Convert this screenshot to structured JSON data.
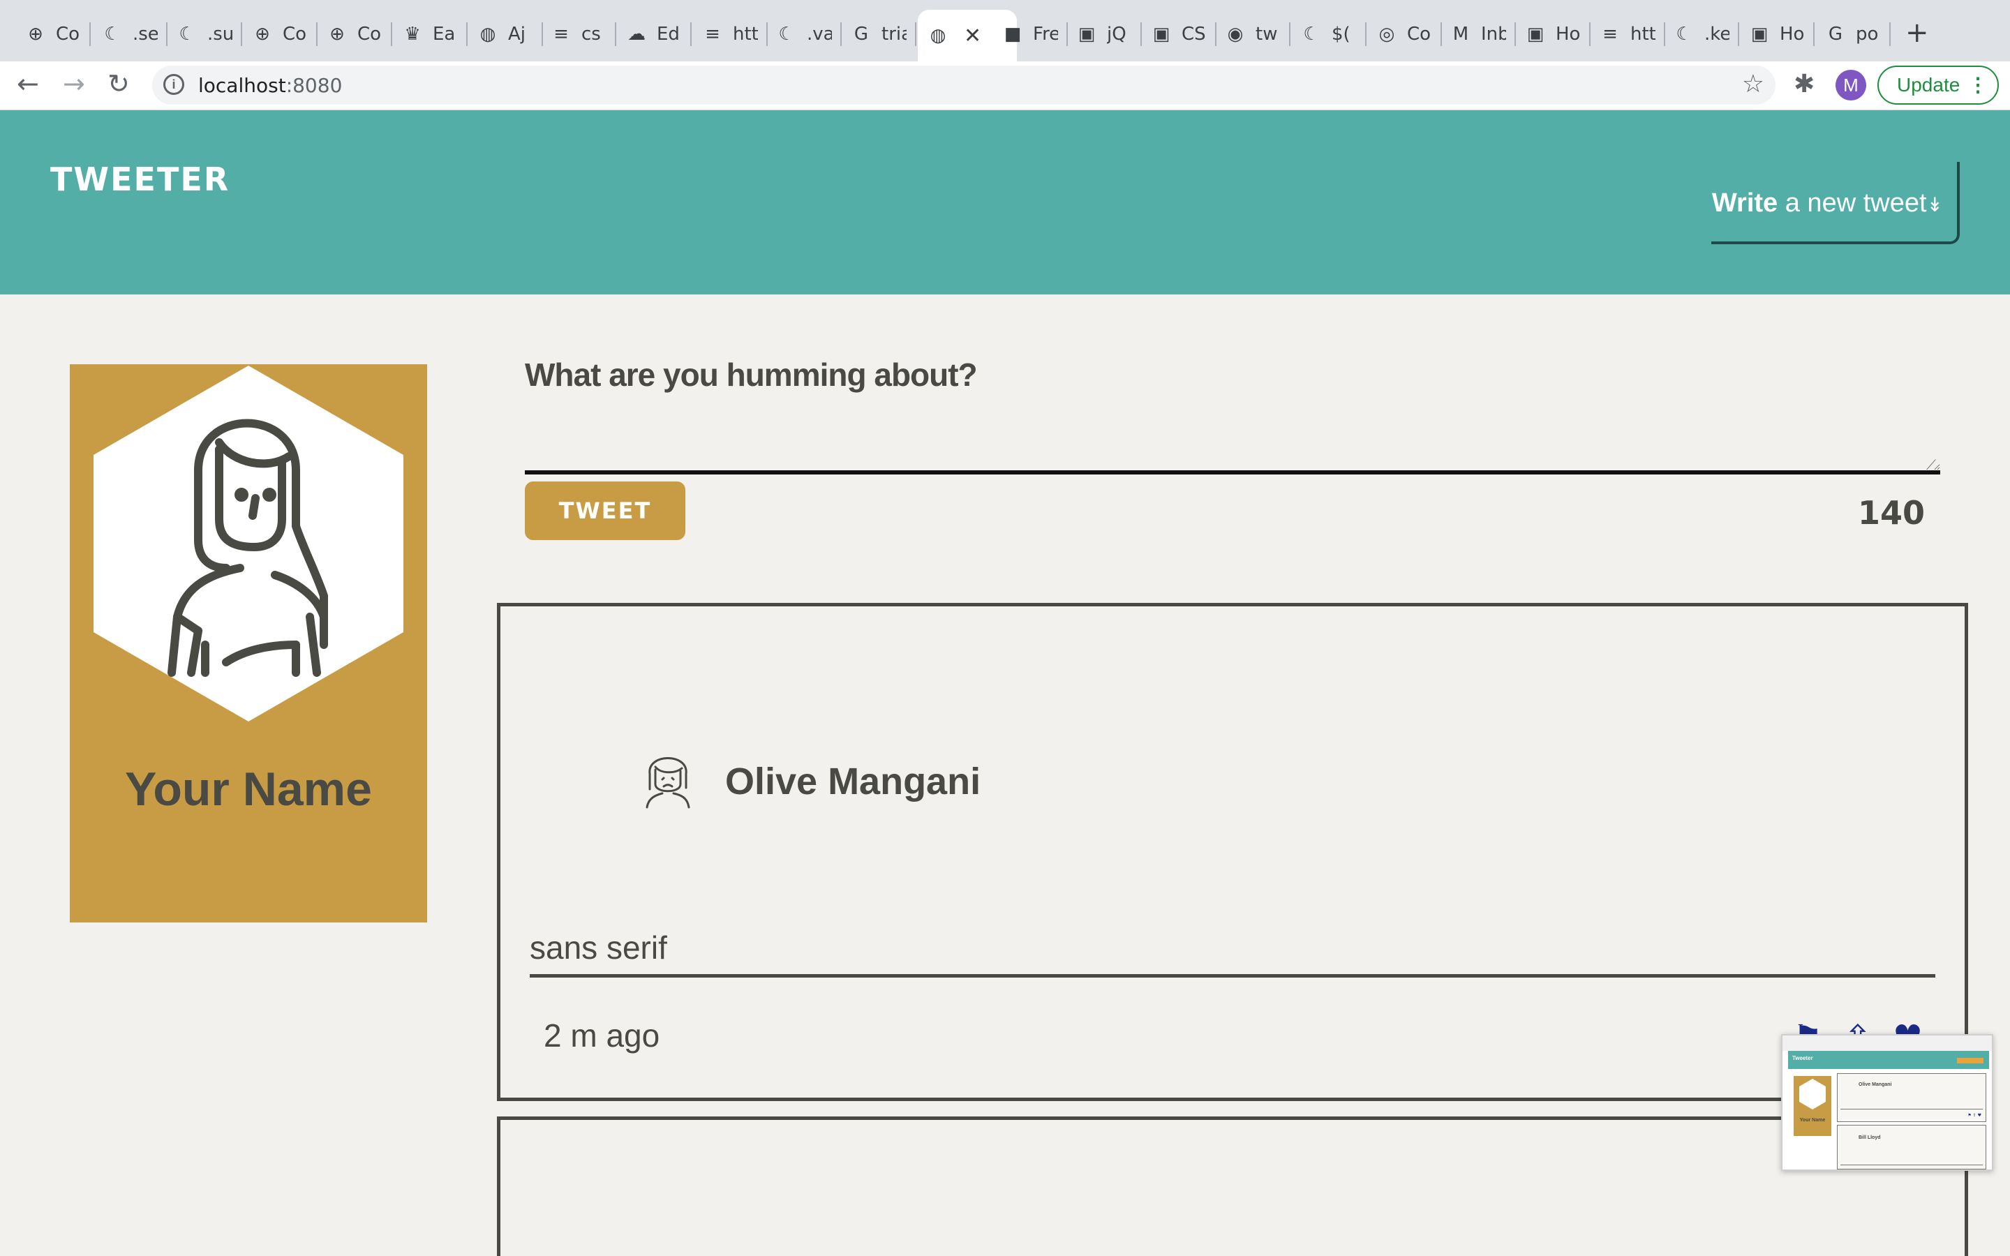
{
  "browser": {
    "tabs": [
      {
        "icon": "⊕",
        "label": "Co",
        "icon_name": "compass-icon"
      },
      {
        "icon": "☾",
        "label": ".se",
        "icon_name": "jquery-icon"
      },
      {
        "icon": "☾",
        "label": ".su",
        "icon_name": "jquery-icon"
      },
      {
        "icon": "⊕",
        "label": "Co",
        "icon_name": "compass-icon"
      },
      {
        "icon": "⊕",
        "label": "Co",
        "icon_name": "compass-icon"
      },
      {
        "icon": "♛",
        "label": "Ea",
        "icon_name": "crown-icon"
      },
      {
        "icon": "◍",
        "label": "Aj",
        "icon_name": "globe-icon"
      },
      {
        "icon": "≡",
        "label": "cs",
        "icon_name": "stackoverflow-icon"
      },
      {
        "icon": "☁",
        "label": "Ed",
        "icon_name": "cloud-icon"
      },
      {
        "icon": "≡",
        "label": "htt",
        "icon_name": "stackoverflow-icon"
      },
      {
        "icon": "☾",
        "label": ".va",
        "icon_name": "jquery-icon"
      },
      {
        "icon": "G",
        "label": "tria",
        "icon_name": "google-icon"
      },
      {
        "icon": "◍",
        "label": "",
        "icon_name": "globe-icon",
        "active": true
      },
      {
        "icon": "■",
        "label": "Fre",
        "icon_name": "freecodecamp-icon"
      },
      {
        "icon": "▣",
        "label": "jQ",
        "icon_name": "w3schools-icon"
      },
      {
        "icon": "▣",
        "label": "CS",
        "icon_name": "w3schools-icon"
      },
      {
        "icon": "◉",
        "label": "tw",
        "icon_name": "github-icon"
      },
      {
        "icon": "☾",
        "label": "$(",
        "icon_name": "jquery-icon"
      },
      {
        "icon": "◎",
        "label": "Co",
        "icon_name": "opera-icon"
      },
      {
        "icon": "M",
        "label": "Inb",
        "icon_name": "gmail-icon"
      },
      {
        "icon": "▣",
        "label": "Ho",
        "icon_name": "w3schools-icon"
      },
      {
        "icon": "≡",
        "label": "htt",
        "icon_name": "stackoverflow-icon"
      },
      {
        "icon": "☾",
        "label": ".ke",
        "icon_name": "jquery-icon"
      },
      {
        "icon": "▣",
        "label": "Ho",
        "icon_name": "w3schools-icon"
      },
      {
        "icon": "G",
        "label": "po",
        "icon_name": "google-icon"
      }
    ],
    "new_tab": "+",
    "close_tab": "✕",
    "url_host": "localhost",
    "url_port": ":8080",
    "avatar_letter": "M",
    "update_label": "Update",
    "update_menu": "⋮",
    "back": "←",
    "forward": "→",
    "reload": "↻",
    "star": "☆",
    "extensions": "✱",
    "info": "i"
  },
  "header": {
    "brand": "TWEETER",
    "write_bold": "Write",
    "write_rest": " a new tweet",
    "write_arrow": "↡"
  },
  "profile": {
    "name": "Your Name"
  },
  "compose": {
    "title": "What are you humming about?",
    "placeholder": "",
    "tweet_button": "TWEET",
    "counter": "140",
    "grip": "⟋"
  },
  "tweets": [
    {
      "name": "Olive Mangani",
      "body": "sans serif",
      "time": "2 m ago",
      "actions": {
        "flag": "⚑",
        "retweet": "⇧",
        "like": "♥"
      }
    }
  ],
  "thumbnail": {
    "brand": "Tweeter",
    "profile_name": "Your Name",
    "tweets": [
      "Olive Mangani",
      "Bill Lloyd"
    ]
  },
  "colors": {
    "header_bg": "#54aea8",
    "accent": "#c89c44",
    "page_bg": "#f3f1ed",
    "text": "#4a4a44",
    "action_icons": "#1b2a86"
  }
}
